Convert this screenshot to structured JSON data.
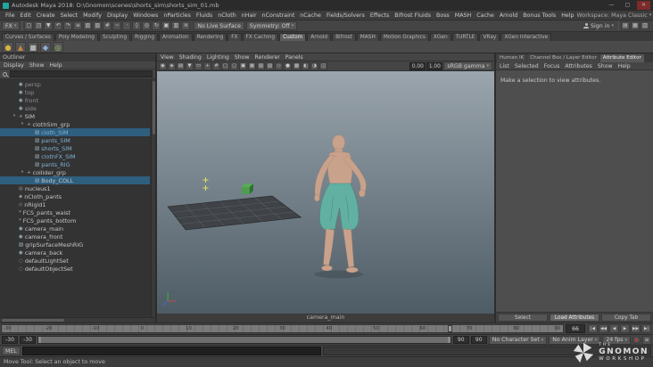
{
  "colors": {
    "accent": "#5285a6",
    "skin": "#c9a28c",
    "skin_shade": "#a57f6b",
    "pants": "#62b0a1",
    "pants_shade": "#3f8a7d",
    "viewport_top": "#9aa5ad",
    "viewport_bottom": "#4e5c66",
    "ground": "#3f4347",
    "grid_line": "#5a6065",
    "cube": "#4f9d4f",
    "marker": "#e0e060"
  },
  "icons": {
    "caret": "▾",
    "search": ""
  },
  "window": {
    "title": "Autodesk Maya 2018: D:\\Gnomon\\scenes\\shorts_sim\\shorts_sim_01.mb",
    "minimize": "—",
    "maximize": "▢",
    "close": "✕",
    "workspace_label": "Workspace:",
    "workspace_value": "Maya Classic"
  },
  "menu_bar": {
    "items": [
      {
        "label": "File"
      },
      {
        "label": "Edit"
      },
      {
        "label": "Create"
      },
      {
        "label": "Select"
      },
      {
        "label": "Modify"
      },
      {
        "label": "Display"
      },
      {
        "label": "Windows"
      },
      {
        "label": "nParticles"
      },
      {
        "label": "Fluids"
      },
      {
        "label": "nCloth"
      },
      {
        "label": "nHair"
      },
      {
        "label": "nConstraint"
      },
      {
        "label": "nCache"
      },
      {
        "label": "Fields/Solvers"
      },
      {
        "label": "Effects"
      },
      {
        "label": "Bifrost Fluids"
      },
      {
        "label": "Boss"
      },
      {
        "label": "MASH"
      },
      {
        "label": "Cache"
      },
      {
        "label": "Arnold"
      },
      {
        "label": "Bonus Tools"
      },
      {
        "label": "Help"
      }
    ]
  },
  "status_line": {
    "menu_set": "FX",
    "live_surface": "No Live Surface",
    "symmetry": "Symmetry: Off",
    "sign_in": "Sign in",
    "icons": [
      {
        "name": "new-scene-icon",
        "glyph": "▢"
      },
      {
        "name": "open-scene-icon",
        "glyph": "◳"
      },
      {
        "name": "save-scene-icon",
        "glyph": "▼"
      },
      {
        "name": "undo-icon",
        "glyph": "↶"
      },
      {
        "name": "redo-icon",
        "glyph": "↷"
      },
      {
        "name": "select-by-hierarchy-icon",
        "glyph": "≡"
      },
      {
        "name": "select-by-object-icon",
        "glyph": "▧"
      },
      {
        "name": "select-by-component-icon",
        "glyph": "▨"
      },
      {
        "name": "snap-to-grid-icon",
        "glyph": "#"
      },
      {
        "name": "snap-to-curve-icon",
        "glyph": "~"
      },
      {
        "name": "snap-to-point-icon",
        "glyph": "·"
      },
      {
        "name": "snap-to-plane-icon",
        "glyph": "◊"
      },
      {
        "name": "make-live-icon",
        "glyph": "◎"
      },
      {
        "name": "construction-history-icon",
        "glyph": "↻"
      },
      {
        "name": "render-frame-icon",
        "glyph": "▣"
      },
      {
        "name": "ipr-render-icon",
        "glyph": "▥"
      },
      {
        "name": "render-settings-icon",
        "glyph": "≋"
      }
    ],
    "panel_toggles": [
      {
        "name": "attribute-editor-toggle-icon",
        "glyph": "▤"
      },
      {
        "name": "tool-settings-toggle-icon",
        "glyph": "▦"
      },
      {
        "name": "channel-box-toggle-icon",
        "glyph": "▥"
      }
    ]
  },
  "shelf": {
    "tabs": [
      {
        "label": "Curves / Surfaces"
      },
      {
        "label": "Poly Modeling"
      },
      {
        "label": "Sculpting"
      },
      {
        "label": "Rigging"
      },
      {
        "label": "Animation"
      },
      {
        "label": "Rendering"
      },
      {
        "label": "FX"
      },
      {
        "label": "FX Caching"
      },
      {
        "label": "Custom",
        "active": true
      },
      {
        "label": "Arnold"
      },
      {
        "label": "Bifrost"
      },
      {
        "label": "MASH"
      },
      {
        "label": "Motion Graphics"
      },
      {
        "label": "XGen"
      },
      {
        "label": "TURTLE"
      },
      {
        "label": "VRay"
      },
      {
        "label": "XGen Interactive"
      }
    ],
    "icons": [
      {
        "name": "shelf-sphere-icon",
        "glyph": "●",
        "color": "#d8b63e"
      },
      {
        "name": "shelf-cone-icon",
        "glyph": "▲",
        "color": "#c8873e"
      },
      {
        "name": "shelf-cube-icon",
        "glyph": "■",
        "color": "#b0b0b0"
      },
      {
        "name": "shelf-plane-icon",
        "glyph": "◆",
        "color": "#8fb3d9"
      },
      {
        "name": "shelf-torus-icon",
        "glyph": "◎",
        "color": "#9ac06a"
      }
    ]
  },
  "outliner": {
    "panel_title": "Outliner",
    "menus": [
      {
        "label": "Display"
      },
      {
        "label": "Show"
      },
      {
        "label": "Help"
      }
    ],
    "items": [
      {
        "name": "persp",
        "depth": 1,
        "arrow": "",
        "glyph": "◉",
        "dim": true
      },
      {
        "name": "top",
        "depth": 1,
        "arrow": "",
        "glyph": "◉",
        "dim": true
      },
      {
        "name": "front",
        "depth": 1,
        "arrow": "",
        "glyph": "◉",
        "dim": true
      },
      {
        "name": "side",
        "depth": 1,
        "arrow": "",
        "glyph": "◉",
        "dim": true
      },
      {
        "name": "SIM",
        "depth": 1,
        "arrow": "▾",
        "glyph": "+"
      },
      {
        "name": "clothSim_grp",
        "depth": 2,
        "arrow": "▾",
        "glyph": "+"
      },
      {
        "name": "cloth_SIM",
        "depth": 3,
        "arrow": "",
        "glyph": "▧",
        "blue": true,
        "selected": true
      },
      {
        "name": "pants_SIM",
        "depth": 3,
        "arrow": "",
        "glyph": "▧",
        "blue": true
      },
      {
        "name": "shorts_SIM",
        "depth": 3,
        "arrow": "",
        "glyph": "▧",
        "blue": true
      },
      {
        "name": "clothFX_SIM",
        "depth": 3,
        "arrow": "",
        "glyph": "▧",
        "blue": true
      },
      {
        "name": "pants_RIG",
        "depth": 3,
        "arrow": "",
        "glyph": "▧",
        "blue": true
      },
      {
        "name": "collider_grp",
        "depth": 2,
        "arrow": "▾",
        "glyph": "+"
      },
      {
        "name": "Body_COLL",
        "depth": 3,
        "arrow": "",
        "glyph": "▧",
        "selected": true
      },
      {
        "name": "nucleus1",
        "depth": 1,
        "arrow": "",
        "glyph": "◎"
      },
      {
        "name": "nCloth_pants",
        "depth": 1,
        "arrow": "",
        "glyph": "◈"
      },
      {
        "name": "nRigid1",
        "depth": 1,
        "arrow": "",
        "glyph": "◇"
      },
      {
        "name": "FCS_pants_waist",
        "depth": 1,
        "arrow": "",
        "glyph": "*"
      },
      {
        "name": "FCS_pants_bottom",
        "depth": 1,
        "arrow": "",
        "glyph": "*"
      },
      {
        "name": "camera_main",
        "depth": 1,
        "arrow": "",
        "glyph": "◉"
      },
      {
        "name": "camera_front",
        "depth": 1,
        "arrow": "",
        "glyph": "◉"
      },
      {
        "name": "gripSurfaceMeshRIG",
        "depth": 1,
        "arrow": "",
        "glyph": "▧"
      },
      {
        "name": "camera_back",
        "depth": 1,
        "arrow": "",
        "glyph": "◉"
      },
      {
        "name": "defaultLightSet",
        "depth": 1,
        "arrow": "",
        "glyph": "◌"
      },
      {
        "name": "defaultObjectSet",
        "depth": 1,
        "arrow": "",
        "glyph": "◌"
      }
    ]
  },
  "viewport": {
    "menus": [
      {
        "label": "View"
      },
      {
        "label": "Shading"
      },
      {
        "label": "Lighting"
      },
      {
        "label": "Show"
      },
      {
        "label": "Renderer"
      },
      {
        "label": "Panels"
      }
    ],
    "toolbar_icons": [
      {
        "name": "select-camera-icon",
        "glyph": "◉"
      },
      {
        "name": "lock-camera-icon",
        "glyph": "◈"
      },
      {
        "name": "camera-attributes-icon",
        "glyph": "▤"
      },
      {
        "name": "bookmark-icon",
        "glyph": "▼"
      },
      {
        "name": "image-plane-icon",
        "glyph": "▭"
      },
      {
        "name": "2d-pan-zoom-icon",
        "glyph": "+"
      },
      {
        "name": "grid-icon",
        "glyph": "#"
      },
      {
        "name": "film-gate-icon",
        "glyph": "▢"
      },
      {
        "name": "resolution-gate-icon",
        "glyph": "◻"
      },
      {
        "name": "gate-mask-icon",
        "glyph": "▣"
      },
      {
        "name": "field-chart-icon",
        "glyph": "▦"
      },
      {
        "name": "safe-action-icon",
        "glyph": "▧"
      },
      {
        "name": "safe-title-icon",
        "glyph": "▨"
      },
      {
        "name": "wireframe-icon",
        "glyph": "◇"
      },
      {
        "name": "smooth-shade-icon",
        "glyph": "●"
      },
      {
        "name": "textured-icon",
        "glyph": "▩"
      },
      {
        "name": "lights-icon",
        "glyph": "◐"
      },
      {
        "name": "shadows-icon",
        "glyph": "◑"
      },
      {
        "name": "xray-icon",
        "glyph": "◫"
      }
    ],
    "exposure": "0.00",
    "gamma": "1.00",
    "view_transform": "sRGB gamma",
    "camera_label": "camera_main"
  },
  "attribute_editor": {
    "tabs": [
      {
        "label": "Human IK"
      },
      {
        "label": "Channel Box / Layer Editor"
      },
      {
        "label": "Attribute Editor",
        "active": true
      }
    ],
    "menus": [
      {
        "label": "List"
      },
      {
        "label": "Selected"
      },
      {
        "label": "Focus"
      },
      {
        "label": "Attributes"
      },
      {
        "label": "Show"
      },
      {
        "label": "Help"
      }
    ],
    "empty_message": "Make a selection to view attributes.",
    "buttons": [
      {
        "label": "Select",
        "name": "select-button"
      },
      {
        "label": "Load Attributes",
        "name": "load-attributes-button",
        "active": true
      },
      {
        "label": "Copy Tab",
        "name": "copy-tab-button"
      }
    ]
  },
  "timeline": {
    "labels": [
      {
        "label": "-30",
        "x": 1
      },
      {
        "label": "-20",
        "x": 8.3
      },
      {
        "label": "-10",
        "x": 16.7
      },
      {
        "label": "0",
        "x": 25
      },
      {
        "label": "10",
        "x": 33.3
      },
      {
        "label": "20",
        "x": 41.7
      },
      {
        "label": "30",
        "x": 50
      },
      {
        "label": "40",
        "x": 58.3
      },
      {
        "label": "50",
        "x": 66.7
      },
      {
        "label": "60",
        "x": 75
      },
      {
        "label": "70",
        "x": 83.3
      },
      {
        "label": "80",
        "x": 91.7
      },
      {
        "label": "90",
        "x": 99
      }
    ],
    "current_frame": "66",
    "marker_style": "left:79.5%",
    "playback": [
      {
        "name": "go-to-start-button",
        "glyph": "|◀"
      },
      {
        "name": "step-back-key-button",
        "glyph": "◀◀"
      },
      {
        "name": "play-backward-button",
        "glyph": "◀"
      },
      {
        "name": "play-forward-button",
        "glyph": "▶"
      },
      {
        "name": "step-forward-key-button",
        "glyph": "▶▶"
      },
      {
        "name": "go-to-end-button",
        "glyph": "▶|"
      }
    ]
  },
  "range_slider": {
    "anim_start": "-30",
    "play_start": "-30",
    "play_end": "90",
    "anim_end": "90",
    "character_set": "No Character Set",
    "anim_layer": "No Anim Layer",
    "fps": "24 fps"
  },
  "command_line": {
    "label": "MEL",
    "input_value": "",
    "result": ""
  },
  "help_line": {
    "text": "Move Tool: Select an object to move"
  },
  "watermark": {
    "the": "THE",
    "gnomon": "GNOMON",
    "workshop": "WORKSHOP"
  }
}
